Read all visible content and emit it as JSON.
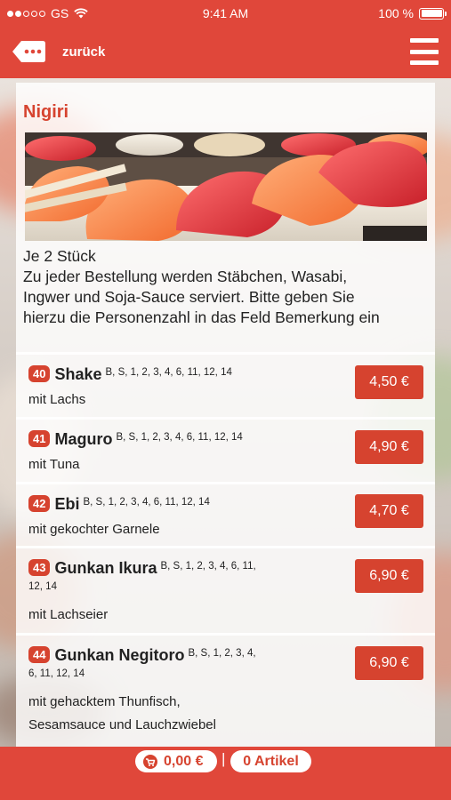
{
  "status_bar": {
    "carrier": "GS",
    "time": "9:41 AM",
    "battery": "100 %"
  },
  "nav": {
    "back_label": "zurück"
  },
  "section": {
    "title": "Nigiri",
    "hero_alt": "Nigiri Sushi",
    "description_lines": [
      "Je 2 Stück",
      "Zu jeder Bestellung werden Stäbchen, Wasabi,",
      "Ingwer und Soja-Sauce serviert. Bitte geben Sie",
      "hierzu die Personenzahl in das Feld Bemerkung ein"
    ]
  },
  "items": [
    {
      "number": "40",
      "name": "Shake",
      "allergens": "B, S, 1, 2, 3, 4, 6, 11, 12, 14",
      "allergens_wrap": "",
      "description": [
        "mit Lachs"
      ],
      "price": "4,50 €"
    },
    {
      "number": "41",
      "name": "Maguro",
      "allergens": "B, S, 1, 2, 3, 4, 6, 11, 12, 14",
      "allergens_wrap": "",
      "description": [
        "mit Tuna"
      ],
      "price": "4,90 €"
    },
    {
      "number": "42",
      "name": "Ebi",
      "allergens": "B, S, 1, 2, 3, 4, 6, 11, 12, 14",
      "allergens_wrap": "",
      "description": [
        "mit gekochter Garnele"
      ],
      "price": "4,70 €"
    },
    {
      "number": "43",
      "name": "Gunkan Ikura",
      "allergens": "B, S, 1, 2, 3, 4, 6, 11,",
      "allergens_wrap": "12, 14",
      "description": [
        "mit Lachseier"
      ],
      "price": "6,90 €"
    },
    {
      "number": "44",
      "name": "Gunkan Negitoro",
      "allergens": "B, S, 1, 2, 3, 4,",
      "allergens_wrap": "6, 11, 12, 14",
      "description": [
        "mit gehacktem Thunfisch,",
        "Sesamsauce und Lauchzwiebel"
      ],
      "price": "6,90 €"
    }
  ],
  "cart": {
    "total": "0,00 €",
    "separator": "|",
    "count": "0 Artikel"
  },
  "colors": {
    "brand": "#e0473a",
    "accent": "#d6432f"
  }
}
